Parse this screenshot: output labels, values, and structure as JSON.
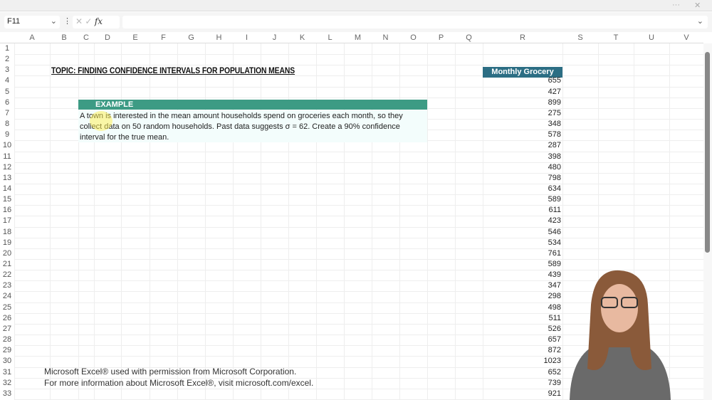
{
  "window": {
    "more_icon": "more-icon",
    "close_icon": "close-icon"
  },
  "formula_bar": {
    "name_box": "F11",
    "fx_label": "fx",
    "formula": ""
  },
  "columns": [
    "A",
    "B",
    "C",
    "D",
    "E",
    "F",
    "G",
    "H",
    "I",
    "J",
    "K",
    "L",
    "M",
    "N",
    "O",
    "P",
    "Q",
    "R",
    "S",
    "T",
    "U",
    "V"
  ],
  "rows": [
    "1",
    "2",
    "3",
    "4",
    "5",
    "6",
    "7",
    "8",
    "9",
    "10",
    "11",
    "12",
    "13",
    "14",
    "15",
    "16",
    "17",
    "18",
    "19",
    "20",
    "21",
    "22",
    "23",
    "24",
    "25",
    "26",
    "27",
    "28",
    "29",
    "30",
    "31",
    "32",
    "33"
  ],
  "sheet": {
    "title": "TOPIC: FINDING CONFIDENCE INTERVALS FOR POPULATION MEANS",
    "example_header": "EXAMPLE",
    "example_text": "A town is interested in the mean amount households spend on groceries each month, so they collect data on 50 random households. Past data suggests σ = 62. Create a 90% confidence interval for the true mean.",
    "data_header": "Monthly Grocery Cost",
    "values": [
      "655",
      "427",
      "899",
      "275",
      "348",
      "578",
      "287",
      "398",
      "480",
      "798",
      "634",
      "589",
      "611",
      "423",
      "546",
      "534",
      "761",
      "589",
      "439",
      "347",
      "298",
      "498",
      "511",
      "526",
      "657",
      "872",
      "1023",
      "652",
      "739",
      "921"
    ]
  },
  "credit": [
    "Microsoft Excel® used with permission from Microsoft Corporation.",
    "For more information about Microsoft Excel®, visit microsoft.com/excel."
  ],
  "colors": {
    "example_header": "#3d9b84",
    "data_header": "#2c6e84"
  }
}
